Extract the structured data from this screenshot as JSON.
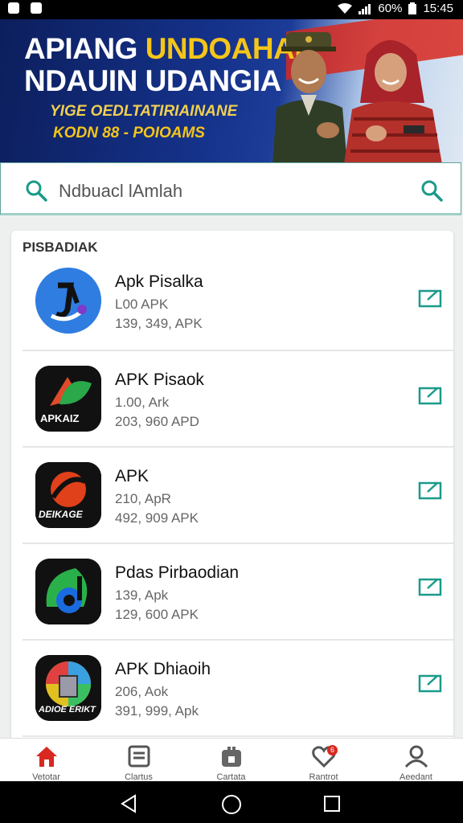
{
  "status_bar": {
    "battery": "60%",
    "time": "15:45"
  },
  "banner": {
    "line1_white": "APIANG",
    "line1_yellow": "UNDOAHAN",
    "line2": "NDAUIN UDANGIA",
    "line3": "YIGE OEDLTATIRIAINANE",
    "line4": "KODN 88 - POIOAMS"
  },
  "search": {
    "placeholder": "Ndbuacl lAmlah"
  },
  "list": {
    "header": "PISBADIAK",
    "apps": [
      {
        "name": "Apk Pisalka",
        "size": "L00 APK",
        "downloads": "139, 349, APK",
        "icon": "music-note-icon",
        "color": "#2f7de1"
      },
      {
        "name": "APK Pisaok",
        "size": "1.00, Ark",
        "downloads": "203, 960 APD",
        "icon": "leaf-icon",
        "color": "#111111",
        "badge": "APKAIZ"
      },
      {
        "name": "APK",
        "size": "210, ApR",
        "downloads": "492, 909 APK",
        "icon": "shield-icon",
        "color": "#111111",
        "badge": "DEIKAGE"
      },
      {
        "name": "Pdas Pirbaodian",
        "size": "139, Apk",
        "downloads": "129, 600 APK",
        "icon": "green-note-icon",
        "color": "#111111"
      },
      {
        "name": "APK Dhiaoih",
        "size": "206, Aok",
        "downloads": "391, 999, Apk",
        "icon": "rainbow-cube-icon",
        "color": "#111111",
        "badge": "ADIOE ERIKT"
      }
    ]
  },
  "bottom_nav": [
    {
      "label": "Vetotar",
      "icon": "home-icon",
      "active": true
    },
    {
      "label": "Clartus",
      "icon": "list-icon",
      "active": false
    },
    {
      "label": "Cartata",
      "icon": "bag-icon",
      "active": false
    },
    {
      "label": "Rantrot",
      "icon": "heart-icon",
      "active": false,
      "badge": "6"
    },
    {
      "label": "Aeedant",
      "icon": "user-icon",
      "active": false
    }
  ],
  "colors": {
    "accent": "#1a9a8a",
    "active_nav": "#d8281f"
  }
}
